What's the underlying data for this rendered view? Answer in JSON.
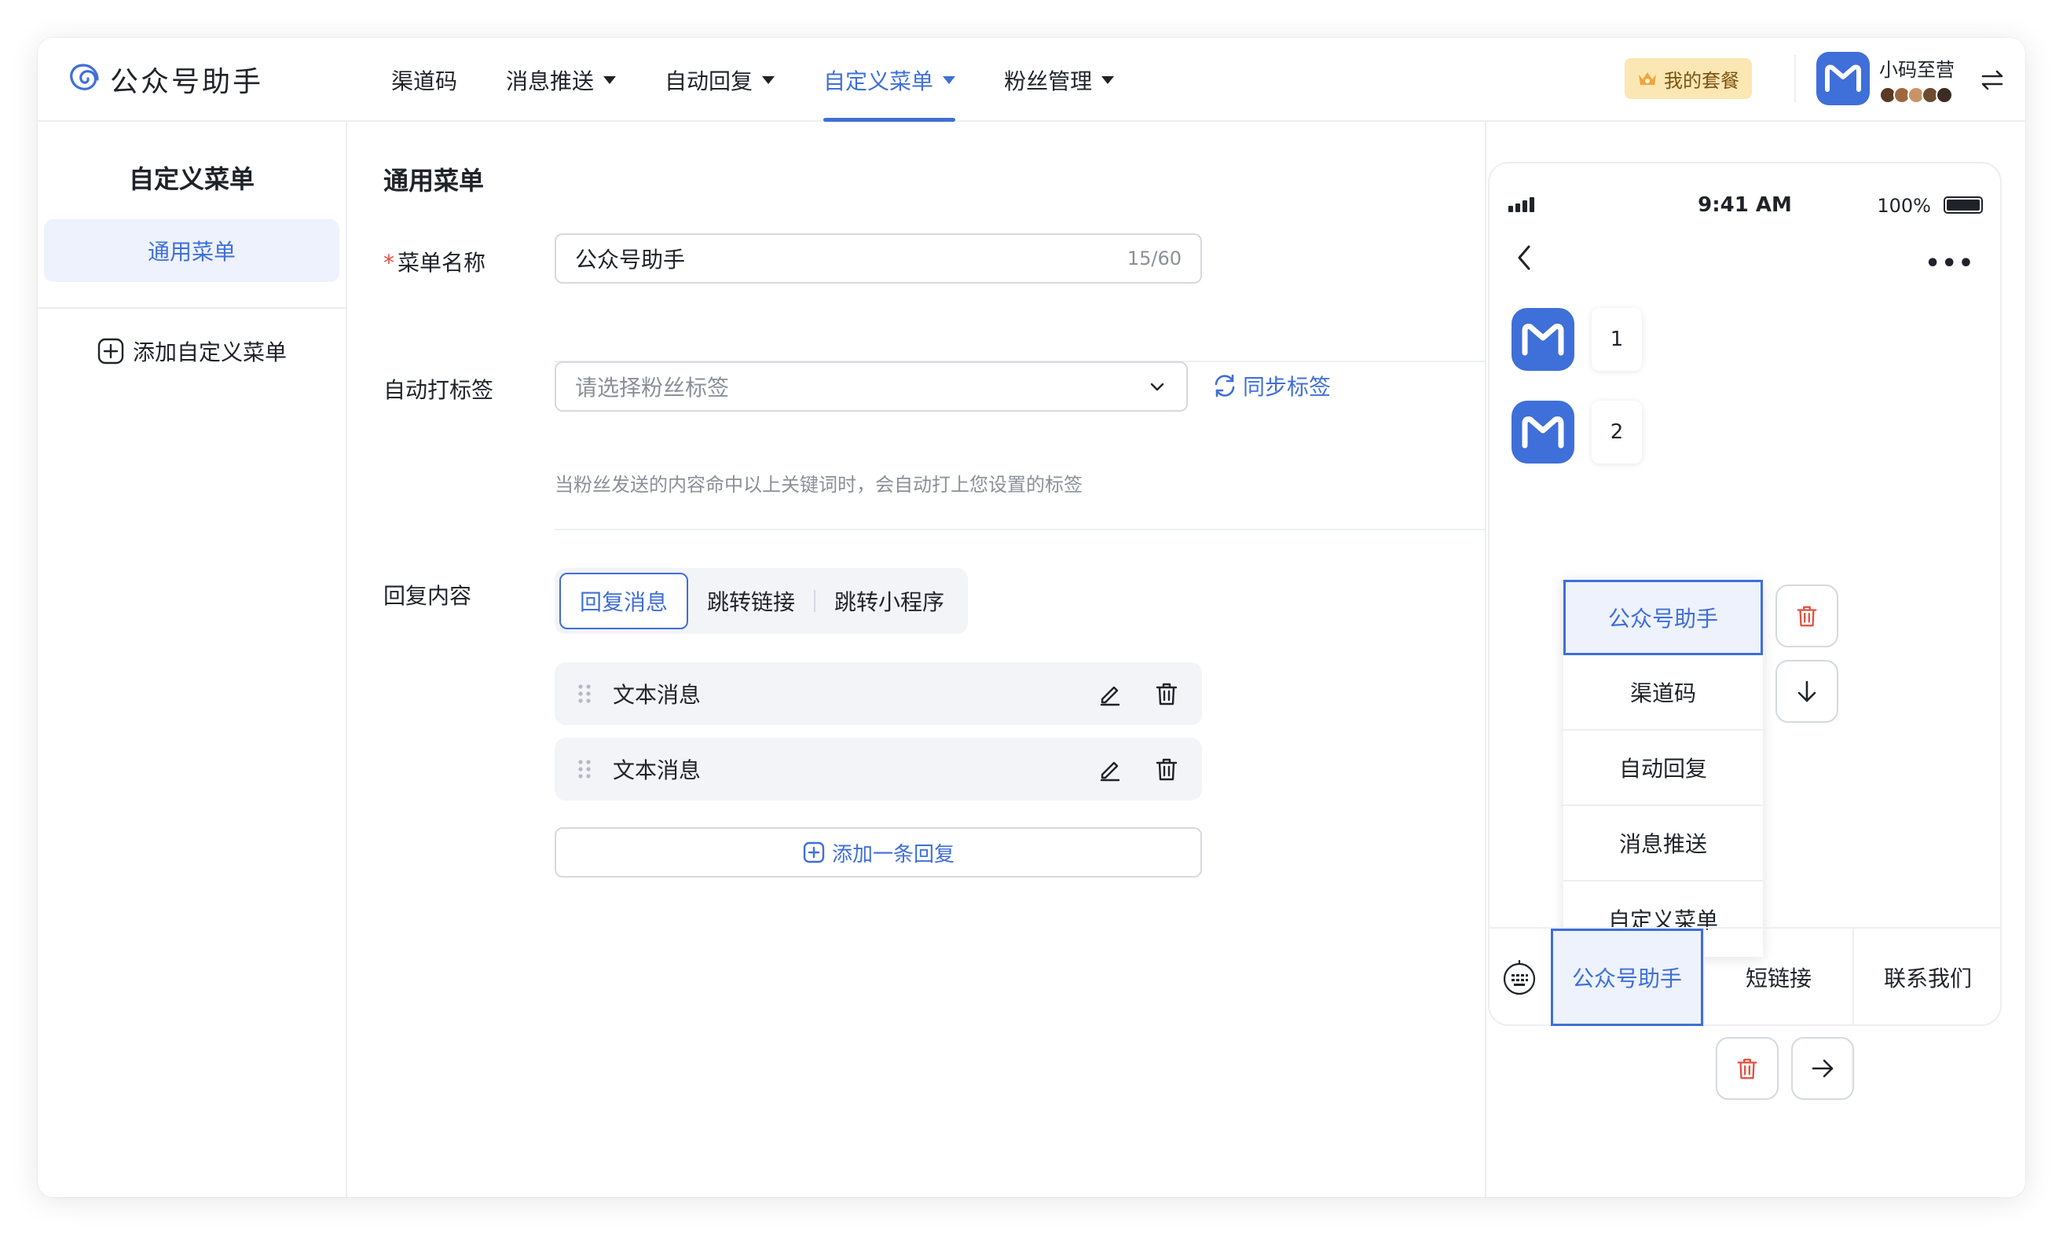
{
  "brand": {
    "name": "公众号助手",
    "logo_icon": "spiral-logo-icon"
  },
  "nav": {
    "items": [
      {
        "label": "渠道码",
        "dropdown": false
      },
      {
        "label": "消息推送",
        "dropdown": true
      },
      {
        "label": "自动回复",
        "dropdown": true
      },
      {
        "label": "自定义菜单",
        "dropdown": true,
        "active": true
      },
      {
        "label": "粉丝管理",
        "dropdown": true
      }
    ],
    "plan_label": "我的套餐",
    "user_name": "小码至营"
  },
  "sidebar": {
    "title": "自定义菜单",
    "items": [
      {
        "label": "通用菜单",
        "active": true
      }
    ],
    "add_label": "添加自定义菜单"
  },
  "form": {
    "section_title": "通用菜单",
    "menu_name": {
      "label": "菜单名称",
      "required_mark": "*",
      "value": "公众号助手",
      "count": "15/60"
    },
    "auto_tag": {
      "label": "自动打标签",
      "placeholder": "请选择粉丝标签",
      "sync_label": "同步标签",
      "hint": "当粉丝发送的内容命中以上关键词时，会自动打上您设置的标签"
    },
    "reply": {
      "label": "回复内容",
      "tabs": [
        "回复消息",
        "跳转链接",
        "跳转小程序"
      ],
      "active_tab": "回复消息",
      "items": [
        "文本消息",
        "文本消息"
      ],
      "add_label": "添加一条回复"
    }
  },
  "phone": {
    "time": "9:41 AM",
    "battery": "100%",
    "messages": [
      "1",
      "2"
    ],
    "submenu": [
      "公众号助手",
      "渠道码",
      "自动回复",
      "消息推送",
      "自定义菜单"
    ],
    "submenu_active": "公众号助手",
    "tabs": [
      "公众号助手",
      "短链接",
      "联系我们"
    ],
    "tab_active": "公众号助手"
  },
  "colors": {
    "accent": "#3f6fd8",
    "danger": "#e34d3e",
    "plan_bg": "#fbe7b3"
  }
}
